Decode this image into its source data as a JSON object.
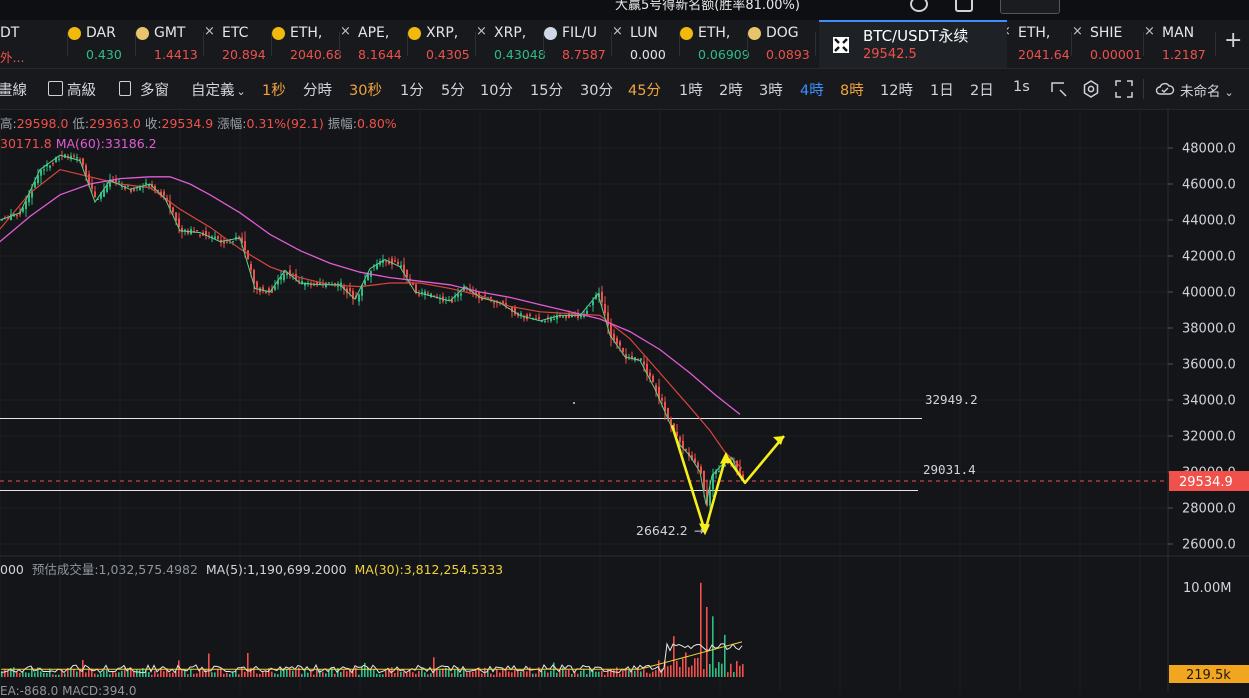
{
  "top_strip": {
    "notice": "大赢5号得新名额(胜率81.00%)"
  },
  "tickers": [
    {
      "symbol": "DT",
      "price": "外...",
      "dir": "neg",
      "icon": "none"
    },
    {
      "symbol": "DAR",
      "price": "0.430",
      "dir": "pos",
      "icon": "dot",
      "color": "#f0b90b"
    },
    {
      "symbol": "GMT",
      "price": "1.4413",
      "dir": "neg",
      "icon": "dot",
      "color": "#e8c46a"
    },
    {
      "symbol": "ETC",
      "price": "20.894",
      "dir": "neg",
      "icon": "x"
    },
    {
      "symbol": "ETH,",
      "price": "2040.68",
      "dir": "neg",
      "icon": "dot",
      "color": "#f0b90b"
    },
    {
      "symbol": "APE,",
      "price": "8.1644",
      "dir": "neg",
      "icon": "x"
    },
    {
      "symbol": "XRP,",
      "price": "0.4305",
      "dir": "neg",
      "icon": "dot",
      "color": "#f0b90b"
    },
    {
      "symbol": "XRP,",
      "price": "0.43048",
      "dir": "pos",
      "icon": "x"
    },
    {
      "symbol": "FIL/U",
      "price": "8.7587",
      "dir": "neg",
      "icon": "dot",
      "color": "#cfd8e6"
    },
    {
      "symbol": "LUN",
      "price": "0.000",
      "dir": "neutral",
      "icon": "x"
    },
    {
      "symbol": "ETH,",
      "price": "0.06909",
      "dir": "pos",
      "icon": "dot",
      "color": "#f0b90b"
    },
    {
      "symbol": "DOG",
      "price": "0.0893",
      "dir": "neg",
      "icon": "dot",
      "color": "#e8c46a"
    }
  ],
  "active_tab": {
    "title": "BTC/USDT永续",
    "price": "29542.5"
  },
  "tickers_right": [
    {
      "symbol": "ETH,",
      "price": "2041.64",
      "dir": "neg",
      "icon": "x"
    },
    {
      "symbol": "SHIE",
      "price": "0.00001",
      "dir": "neg",
      "icon": "x"
    },
    {
      "symbol": "MAN",
      "price": "1.2187",
      "dir": "neg",
      "icon": "x"
    }
  ],
  "toolbar": {
    "left_label": "畫線",
    "advanced_label": "高級",
    "multi_window_label": "多窗",
    "custom_label": "自定義",
    "intervals": [
      {
        "label": "1秒",
        "state": "active-orange"
      },
      {
        "label": "分時",
        "state": ""
      },
      {
        "label": "30秒",
        "state": "active-orange"
      },
      {
        "label": "1分",
        "state": ""
      },
      {
        "label": "5分",
        "state": ""
      },
      {
        "label": "10分",
        "state": ""
      },
      {
        "label": "15分",
        "state": ""
      },
      {
        "label": "30分",
        "state": ""
      },
      {
        "label": "45分",
        "state": "active-orange"
      },
      {
        "label": "1時",
        "state": ""
      },
      {
        "label": "2時",
        "state": ""
      },
      {
        "label": "3時",
        "state": ""
      },
      {
        "label": "4時",
        "state": "active-blue"
      },
      {
        "label": "8時",
        "state": "active-orange"
      },
      {
        "label": "12時",
        "state": ""
      },
      {
        "label": "1日",
        "state": ""
      },
      {
        "label": "2日",
        "state": ""
      },
      {
        "label": "1s",
        "state": ""
      }
    ],
    "layout_name": "未命名"
  },
  "ohlc": {
    "high_label": "高:",
    "high": "29598.0",
    "low_label": "低:",
    "low": "29363.0",
    "close_label": "收:",
    "close": "29534.9",
    "change_label": "漲幅:",
    "change": "0.31%(92.1)",
    "amplitude_label": "振幅:",
    "amplitude": "0.80%"
  },
  "ma_line": {
    "ma_a": "30171.8",
    "ma_b": "MA(60):33186.2"
  },
  "levels": {
    "resistance": "32949.2",
    "support": "29031.4",
    "low_marker": "26642.2",
    "current": "29534.9"
  },
  "volume": {
    "prefix": "000",
    "estimated_label": "预估成交量:1,032,575.4982",
    "ma5": "MA(5):1,190,699.2000",
    "ma30": "MA(30):3,812,254.5333",
    "axis_top": "10.00M",
    "current": "219.5k"
  },
  "macd": {
    "text": "EA:-868.0   MACD:394.0"
  },
  "chart_data": {
    "type": "candlestick",
    "y_ticks": [
      48000,
      46000,
      44000,
      42000,
      40000,
      38000,
      36000,
      34000,
      32000,
      30000,
      28000,
      26000
    ],
    "ylim": [
      25000,
      49000
    ],
    "close_path": [
      [
        0,
        44000
      ],
      [
        20,
        44400
      ],
      [
        40,
        46800
      ],
      [
        60,
        47600
      ],
      [
        80,
        47300
      ],
      [
        95,
        45000
      ],
      [
        110,
        46200
      ],
      [
        130,
        45700
      ],
      [
        150,
        46000
      ],
      [
        165,
        45200
      ],
      [
        180,
        43400
      ],
      [
        200,
        43300
      ],
      [
        220,
        42800
      ],
      [
        240,
        43000
      ],
      [
        255,
        40200
      ],
      [
        270,
        40000
      ],
      [
        285,
        41200
      ],
      [
        300,
        40500
      ],
      [
        320,
        40400
      ],
      [
        340,
        40400
      ],
      [
        355,
        39600
      ],
      [
        370,
        41300
      ],
      [
        385,
        41800
      ],
      [
        400,
        41400
      ],
      [
        415,
        40000
      ],
      [
        430,
        39800
      ],
      [
        450,
        39500
      ],
      [
        465,
        40300
      ],
      [
        480,
        39700
      ],
      [
        500,
        39400
      ],
      [
        520,
        38700
      ],
      [
        540,
        38400
      ],
      [
        560,
        38700
      ],
      [
        580,
        38700
      ],
      [
        598,
        39900
      ],
      [
        610,
        37600
      ],
      [
        625,
        36400
      ],
      [
        640,
        36200
      ],
      [
        655,
        34600
      ],
      [
        670,
        32700
      ],
      [
        680,
        31500
      ],
      [
        690,
        30900
      ],
      [
        700,
        30000
      ],
      [
        706,
        28200
      ],
      [
        712,
        29800
      ],
      [
        722,
        30400
      ],
      [
        732,
        30800
      ],
      [
        742,
        29500
      ]
    ],
    "ma_slow": [
      [
        0,
        42800
      ],
      [
        30,
        44200
      ],
      [
        60,
        45400
      ],
      [
        90,
        46000
      ],
      [
        120,
        46300
      ],
      [
        150,
        46400
      ],
      [
        170,
        46400
      ],
      [
        190,
        46000
      ],
      [
        210,
        45400
      ],
      [
        240,
        44400
      ],
      [
        270,
        43200
      ],
      [
        300,
        42300
      ],
      [
        330,
        41600
      ],
      [
        360,
        41100
      ],
      [
        390,
        40800
      ],
      [
        420,
        40600
      ],
      [
        450,
        40400
      ],
      [
        480,
        40000
      ],
      [
        510,
        39700
      ],
      [
        540,
        39300
      ],
      [
        570,
        38900
      ],
      [
        600,
        38500
      ],
      [
        630,
        37800
      ],
      [
        660,
        36800
      ],
      [
        690,
        35500
      ],
      [
        715,
        34300
      ],
      [
        740,
        33200
      ]
    ],
    "ma_mid": [
      [
        0,
        43500
      ],
      [
        30,
        45500
      ],
      [
        60,
        46800
      ],
      [
        90,
        46400
      ],
      [
        120,
        46000
      ],
      [
        150,
        45800
      ],
      [
        180,
        44600
      ],
      [
        210,
        43600
      ],
      [
        240,
        42400
      ],
      [
        270,
        41400
      ],
      [
        300,
        40800
      ],
      [
        330,
        40400
      ],
      [
        360,
        40300
      ],
      [
        390,
        40500
      ],
      [
        420,
        40500
      ],
      [
        450,
        40200
      ],
      [
        480,
        39800
      ],
      [
        510,
        39200
      ],
      [
        540,
        38900
      ],
      [
        570,
        38800
      ],
      [
        600,
        38700
      ],
      [
        630,
        37400
      ],
      [
        660,
        35500
      ],
      [
        690,
        33600
      ],
      [
        710,
        32300
      ],
      [
        725,
        31100
      ],
      [
        742,
        30200
      ]
    ],
    "projection": [
      [
        672,
        32600
      ],
      [
        705,
        26700
      ],
      [
        726,
        30900
      ],
      [
        745,
        29400
      ],
      [
        784,
        32000
      ]
    ],
    "volume_bars_seed": 7,
    "volume_spikes": [
      [
        672,
        3.6
      ],
      [
        684,
        2.4
      ],
      [
        700,
        10.7
      ],
      [
        706,
        6.8
      ],
      [
        712,
        5.9
      ],
      [
        724,
        4.2
      ]
    ]
  }
}
